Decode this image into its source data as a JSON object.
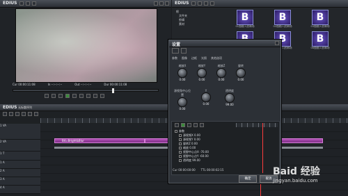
{
  "app": {
    "player_title": "EDIUS",
    "bin_title": "EDIUS",
    "timeline_title": "EDIUS",
    "timeline_sequence": "无标题序列"
  },
  "player": {
    "cur_label": "Cur 00:00:11:08",
    "in_label": "In --:--:--:--",
    "out_label": "Out --:--:--:--",
    "dur_label": "Dur 00:00:11:08"
  },
  "bin": {
    "tree_items": [
      "根",
      "文件夹",
      "剪辑",
      "素材"
    ],
    "thumbnails": [
      {
        "glyph": "B",
        "label": "01视频(1)的转场"
      },
      {
        "glyph": "B",
        "label": "02视频(1)的转场"
      },
      {
        "glyph": "B",
        "label": "03视频(1)的转场"
      },
      {
        "glyph": "B",
        "label": "04视频(1)的转场"
      },
      {
        "glyph": "B",
        "label": "05视频(1)的转场"
      },
      {
        "glyph": "B",
        "label": "06视频(1)的转场"
      }
    ]
  },
  "dialog": {
    "title": "设置",
    "tabs": [
      "参数",
      "图像",
      "边框",
      "光照",
      "其他选项"
    ],
    "knobs_row1": [
      {
        "label": "缩放X",
        "value": "0.00"
      },
      {
        "label": "缩放Y",
        "value": "0.00"
      },
      {
        "label": "缩放Z",
        "value": "0.00"
      },
      {
        "label": "旋转",
        "value": "0.00"
      }
    ],
    "knobs_row2": [
      {
        "label": "源视角中心位置",
        "value": "0.00"
      },
      {
        "label": "Y",
        "value": "0.00"
      },
      {
        "label": "透明度",
        "value": "99.00"
      }
    ],
    "layer_list": [
      "参数",
      "源视频X  0.00",
      "源视频Y  0.00",
      "旋转Z  0.00",
      "缩放  0.00",
      "视野中心点X  -70.00",
      "视野中心点Y  -60.00",
      "透明度  99.00"
    ],
    "timecode_left": "Cur 00:00:00:00",
    "timecode_right": "TTL 00:00:02:15",
    "ok_label": "确定",
    "cancel_label": "取消"
  },
  "timeline": {
    "tracks": [
      {
        "name": "1 VA"
      },
      {
        "name": "2 VA"
      },
      {
        "name": "1 T"
      },
      {
        "name": "1 A"
      },
      {
        "name": "2 A"
      },
      {
        "name": "3 A"
      },
      {
        "name": "4 A"
      }
    ],
    "clip_label": "B4=Bright&Blur"
  },
  "watermark": {
    "text": "Baid 经验",
    "url": "jingyan.baidu.com"
  }
}
